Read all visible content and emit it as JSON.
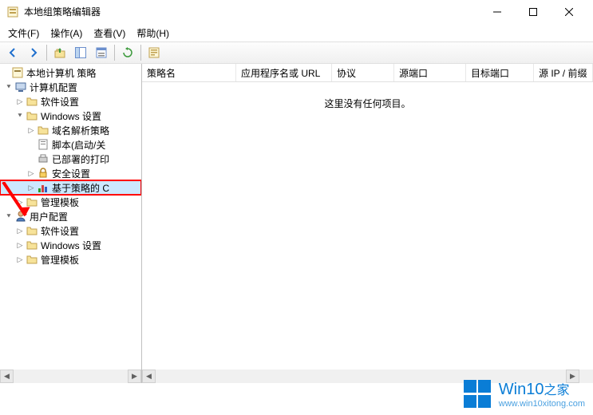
{
  "window": {
    "title": "本地组策略编辑器"
  },
  "menus": {
    "file": "文件(F)",
    "action": "操作(A)",
    "view": "查看(V)",
    "help": "帮助(H)"
  },
  "tree": {
    "root": "本地计算机 策略",
    "computer_config": "计算机配置",
    "software_settings1": "软件设置",
    "windows_settings1": "Windows 设置",
    "dns_policy": "域名解析策略",
    "scripts": "脚本(启动/关",
    "deployed_printers": "已部署的打印",
    "security_settings": "安全设置",
    "policy_based": "基于策略的 C",
    "admin_templates1": "管理模板",
    "user_config": "用户配置",
    "software_settings2": "软件设置",
    "windows_settings2": "Windows 设置",
    "admin_templates2": "管理模板"
  },
  "columns": {
    "name": "策略名",
    "app_url": "应用程序名或 URL",
    "protocol": "协议",
    "src_port": "源端口",
    "dst_port": "目标端口",
    "src_ip": "源 IP / 前缀"
  },
  "empty": "这里没有任何项目。",
  "watermark": {
    "text_main": "Win10",
    "text_sub": "之家",
    "url": "www.win10xitong.com"
  }
}
